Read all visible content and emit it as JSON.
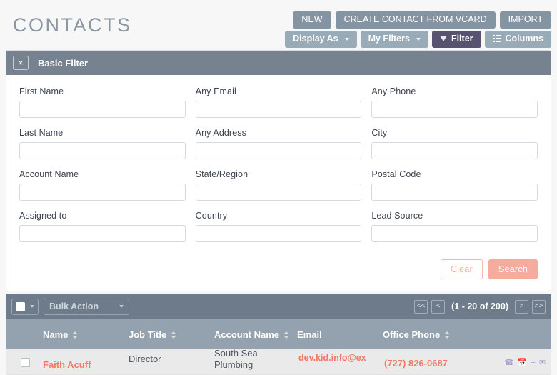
{
  "header": {
    "title": "CONTACTS",
    "primary_buttons": [
      {
        "label": "NEW",
        "name": "new-button"
      },
      {
        "label": "CREATE CONTACT FROM VCARD",
        "name": "create-contact-from-vcard-button"
      },
      {
        "label": "IMPORT",
        "name": "import-button"
      }
    ],
    "secondary_buttons": [
      {
        "label": "Display As",
        "name": "display-as-button",
        "icon": "chevron-down-icon",
        "active": false
      },
      {
        "label": "My Filters",
        "name": "my-filters-button",
        "icon": "chevron-down-icon",
        "active": false
      },
      {
        "label": "Filter",
        "name": "filter-button",
        "icon": "funnel-icon",
        "active": true
      },
      {
        "label": "Columns",
        "name": "columns-button",
        "icon": "columns-list-icon",
        "active": false
      }
    ]
  },
  "filter_panel": {
    "title": "Basic Filter",
    "close_label": "×",
    "fields": [
      {
        "label": "First Name",
        "value": "",
        "placeholder": "",
        "name": "first-name-input"
      },
      {
        "label": "Any Email",
        "value": "",
        "placeholder": "",
        "name": "any-email-input"
      },
      {
        "label": "Any Phone",
        "value": "",
        "placeholder": "",
        "name": "any-phone-input"
      },
      {
        "label": "Last Name",
        "value": "",
        "placeholder": "",
        "name": "last-name-input"
      },
      {
        "label": "Any Address",
        "value": "",
        "placeholder": "",
        "name": "any-address-input"
      },
      {
        "label": "City",
        "value": "",
        "placeholder": "",
        "name": "city-input"
      },
      {
        "label": "Account Name",
        "value": "",
        "placeholder": "",
        "name": "account-name-input"
      },
      {
        "label": "State/Region",
        "value": "",
        "placeholder": "",
        "name": "state-region-input"
      },
      {
        "label": "Postal Code",
        "value": "",
        "placeholder": "",
        "name": "postal-code-input"
      },
      {
        "label": "Assigned to",
        "value": "",
        "placeholder": "",
        "name": "assigned-to-input"
      },
      {
        "label": "Country",
        "value": "",
        "placeholder": "",
        "name": "country-input"
      },
      {
        "label": "Lead Source",
        "value": "",
        "placeholder": "",
        "name": "lead-source-input"
      }
    ],
    "clear_label": "Clear",
    "search_label": "Search"
  },
  "list": {
    "bulk_action_label": "Bulk Action",
    "pagination": {
      "first_label": "<<",
      "prev_label": "<",
      "count_label": "(1 - 20 of 200)",
      "next_label": ">",
      "last_label": ">>"
    },
    "columns": [
      {
        "label": "Name",
        "sortable": true
      },
      {
        "label": "Job Title",
        "sortable": true
      },
      {
        "label": "Account Name",
        "sortable": true
      },
      {
        "label": "Email",
        "sortable": false
      },
      {
        "label": "Office Phone",
        "sortable": true
      }
    ],
    "rows": [
      {
        "name": "Faith Acuff",
        "job_title": "Director",
        "account_name": "South Sea Plumbing",
        "email": "dev.kid.info@ex",
        "office_phone": "(727) 826-0687",
        "actions": [
          "phone-icon",
          "calendar-icon",
          "task-list-icon",
          "envelope-icon"
        ]
      }
    ]
  },
  "colors": {
    "accent_salmon": "#f07a65",
    "header_gray": "#8494a3",
    "filter_active": "#565270",
    "table_header": "#93a2ae",
    "bulk_bar": "#6d7b8a"
  }
}
